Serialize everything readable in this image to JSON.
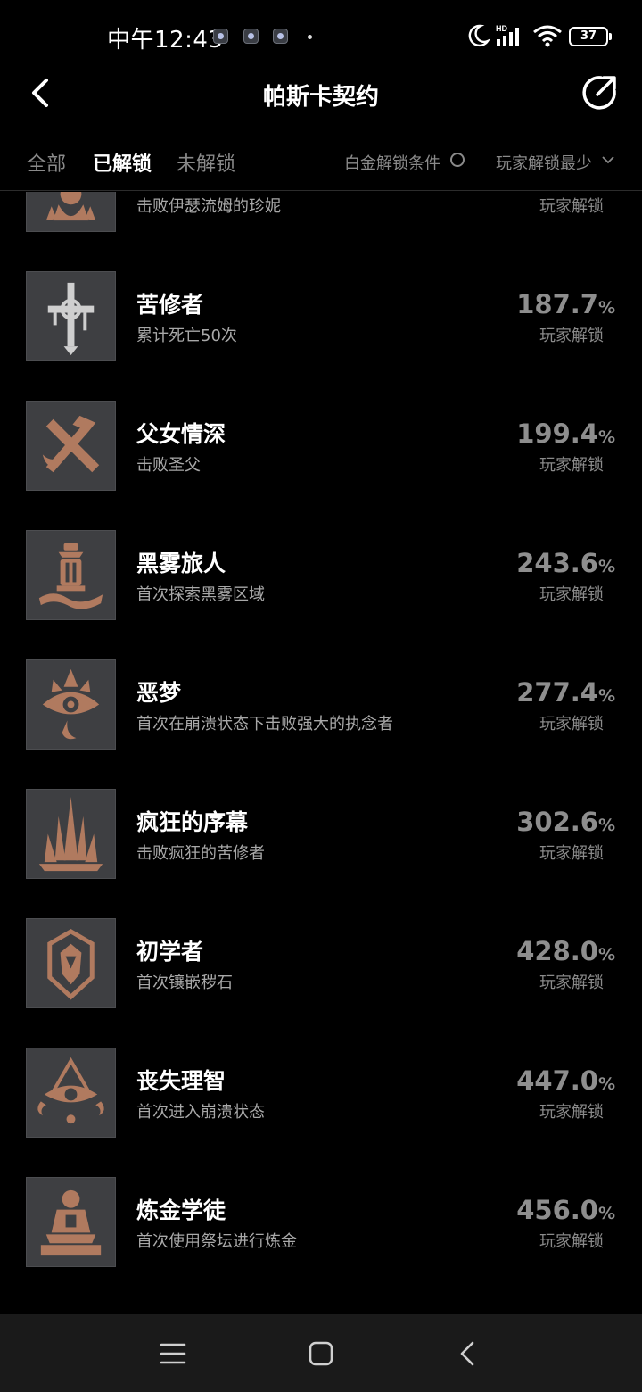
{
  "status_bar": {
    "time": "中午12:43",
    "battery": "37",
    "icons": [
      "notification-app-icon",
      "notification-shield-icon",
      "notification-app-icon",
      "moon-icon",
      "hd-signal-icon",
      "wifi-icon",
      "battery-icon"
    ]
  },
  "header": {
    "title": "帕斯卡契约",
    "back_icon": "chevron-left-icon",
    "share_icon": "share-icon"
  },
  "tabs": {
    "all": "全部",
    "unlocked": "已解锁",
    "locked": "未解锁",
    "active": "已解锁"
  },
  "filters": {
    "platinum": "白金解锁条件",
    "sort": "玩家解锁最少"
  },
  "achievements": [
    {
      "title": "",
      "desc": "击败伊瑟流姆的珍妮",
      "pct": "",
      "unlock_label": "玩家解锁",
      "icon": "figure-emblem-icon"
    },
    {
      "title": "苦修者",
      "desc": "累计死亡50次",
      "pct": "187.7",
      "unlock_label": "玩家解锁",
      "icon": "dripping-cross-icon"
    },
    {
      "title": "父女情深",
      "desc": "击败圣父",
      "pct": "199.4",
      "unlock_label": "玩家解锁",
      "icon": "crossed-weapons-icon"
    },
    {
      "title": "黑雾旅人",
      "desc": "首次探索黑雾区域",
      "pct": "243.6",
      "unlock_label": "玩家解锁",
      "icon": "lantern-mist-icon"
    },
    {
      "title": "恶梦",
      "desc": "首次在崩溃状态下击败强大的执念者",
      "pct": "277.4",
      "unlock_label": "玩家解锁",
      "icon": "crowned-eye-icon"
    },
    {
      "title": "疯狂的序幕",
      "desc": "击败疯狂的苦修者",
      "pct": "302.6",
      "unlock_label": "玩家解锁",
      "icon": "spiked-spire-icon"
    },
    {
      "title": "初学者",
      "desc": "首次镶嵌秽石",
      "pct": "428.0",
      "unlock_label": "玩家解锁",
      "icon": "gem-crest-icon"
    },
    {
      "title": "丧失理智",
      "desc": "首次进入崩溃状态",
      "pct": "447.0",
      "unlock_label": "玩家解锁",
      "icon": "ornate-eye-icon"
    },
    {
      "title": "炼金学徒",
      "desc": "首次使用祭坛进行炼金",
      "pct": "456.0",
      "unlock_label": "玩家解锁",
      "icon": "altar-icon"
    }
  ],
  "percent_unit": "%",
  "nav_bar": {
    "icons": [
      "menu-icon",
      "home-square-icon",
      "back-triangle-icon"
    ]
  },
  "colors": {
    "background": "#000000",
    "badge_bg": "#3e3f42",
    "emblem": "#b07a5f",
    "secondary_text": "#8a8a8a"
  }
}
